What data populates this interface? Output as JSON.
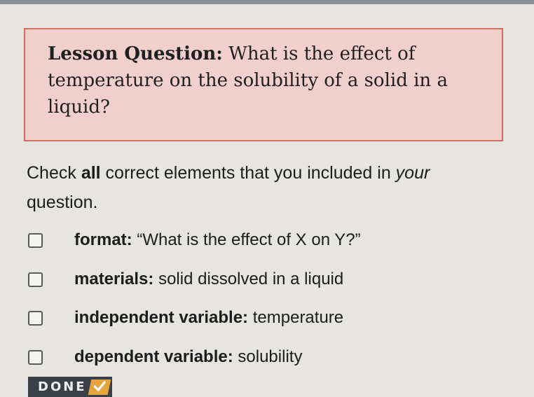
{
  "lesson": {
    "label": "Lesson Question:",
    "question": "What is the effect of temperature on the solubility of a solid in a liquid?"
  },
  "instruction": {
    "part1": "Check ",
    "emphasis_all": "all",
    "part2": " correct elements that you included in ",
    "emphasis_your": "your",
    "part3": " question."
  },
  "options": [
    {
      "key": "format:",
      "value": "“What is the effect of X on Y?”",
      "checked": false
    },
    {
      "key": "materials:",
      "value": "solid dissolved in a liquid",
      "checked": false
    },
    {
      "key": "independent variable:",
      "value": "temperature",
      "checked": false
    },
    {
      "key": "dependent variable:",
      "value": "solubility",
      "checked": false
    }
  ],
  "done_button": {
    "label": "DONE",
    "icon": "checkmark-icon",
    "badge_color": "#e8a43c"
  },
  "colors": {
    "lesson_bg": "#f1cfcc",
    "lesson_border": "#d26e5c",
    "page_bg": "#e6e5e1"
  }
}
